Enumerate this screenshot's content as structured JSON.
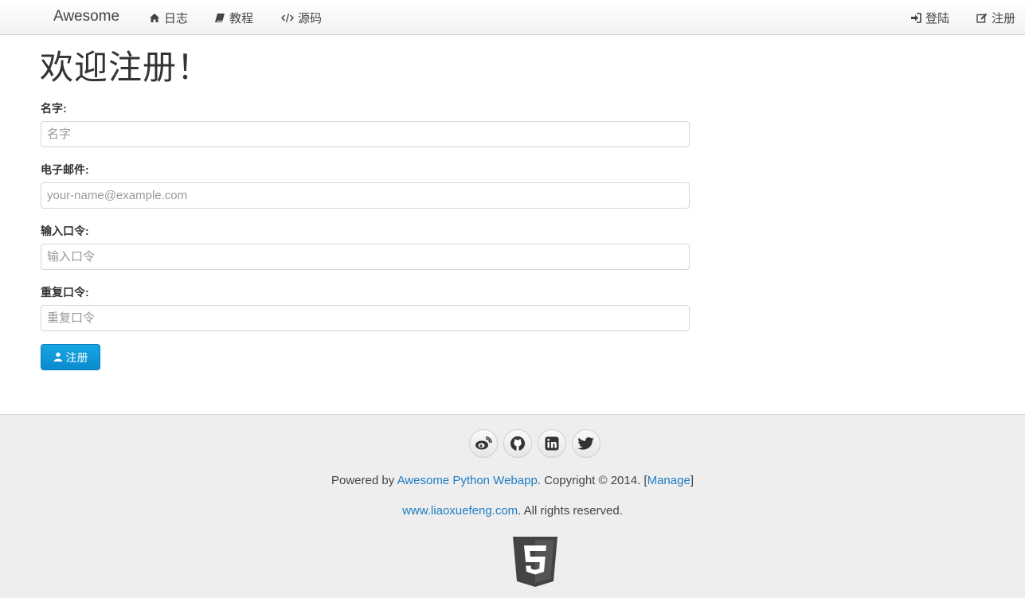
{
  "navbar": {
    "brand": "Awesome",
    "left_items": [
      {
        "label": "日志",
        "icon": "home-icon"
      },
      {
        "label": "教程",
        "icon": "book-icon"
      },
      {
        "label": "源码",
        "icon": "code-icon"
      }
    ],
    "right_items": [
      {
        "label": "登陆",
        "icon": "sign-in-icon"
      },
      {
        "label": "注册",
        "icon": "edit-icon"
      }
    ]
  },
  "main": {
    "title": "欢迎注册！",
    "fields": [
      {
        "label": "名字:",
        "placeholder": "名字",
        "value": ""
      },
      {
        "label": "电子邮件:",
        "placeholder": "your-name@example.com",
        "value": ""
      },
      {
        "label": "输入口令:",
        "placeholder": "输入口令",
        "value": ""
      },
      {
        "label": "重复口令:",
        "placeholder": "重复口令",
        "value": ""
      }
    ],
    "submit_label": "注册",
    "submit_icon": "user-icon"
  },
  "footer": {
    "social": [
      "weibo-icon",
      "github-icon",
      "linkedin-icon",
      "twitter-icon"
    ],
    "powered_prefix": "Powered by ",
    "powered_link": "Awesome Python Webapp",
    "copyright": ". Copyright © 2014. [",
    "manage_link": "Manage",
    "bracket_close": "]",
    "site_link": "www.liaoxuefeng.com",
    "rights": ". All rights reserved.",
    "badge_icon": "html5-icon"
  },
  "colors": {
    "link": "#1e7cc2",
    "primary_button": "#0a8bcd",
    "footer_bg": "#eeeeee"
  }
}
